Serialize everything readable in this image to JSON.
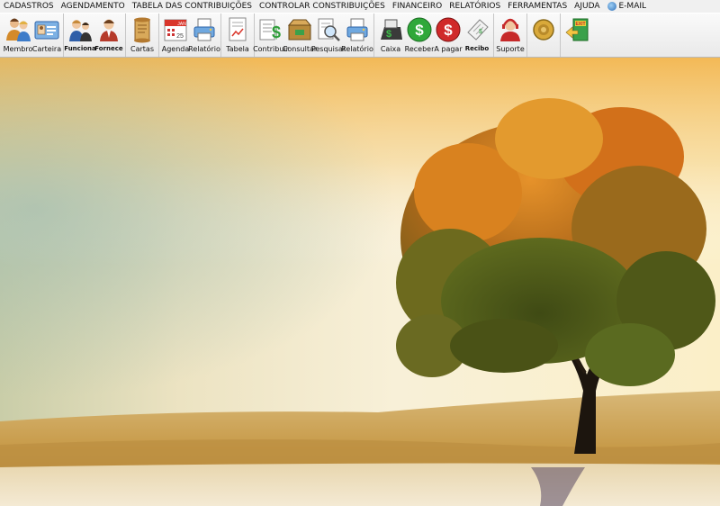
{
  "menubar": {
    "items": [
      "CADASTROS",
      "AGENDAMENTO",
      "TABELA DAS CONTRIBUIÇÕES",
      "CONTROLAR CONSTRIBUIÇÕES",
      "FINANCEIRO",
      "RELATÓRIOS",
      "FERRAMENTAS",
      "AJUDA"
    ],
    "email_label": "E-MAIL"
  },
  "toolbar": {
    "membro": "Membro",
    "carteira": "Carteira",
    "funciona": "Funciona",
    "fornece": "Fornece",
    "cartas": "Cartas",
    "agenda": "Agenda",
    "relatorio": "Relatório",
    "tabela": "Tabela",
    "contribuir": "Contribuir",
    "consultar": "Consultar",
    "pesquisar": "Pesquisar",
    "relatorio2": "Relatório",
    "caixa": "Caixa",
    "receber": "Receber",
    "apagar": "A pagar",
    "recibo": "Recibo",
    "suporte": "Suporte",
    "calendar_month": "JAN",
    "calendar_day": "25",
    "exit_sign": "EXIT"
  },
  "colors": {
    "menubar_bg": "#f0f0f0",
    "toolbar_bg": "#ececec",
    "sky_warm": "#f5c766",
    "field": "#c9a55a",
    "foliage": "#b86a1a"
  }
}
